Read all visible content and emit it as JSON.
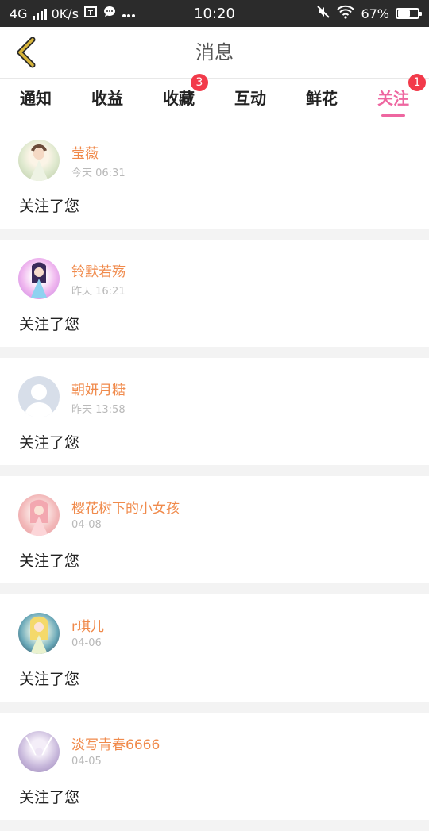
{
  "status_bar": {
    "network": "4G",
    "speed": "0K/s",
    "time": "10:20",
    "battery": "67%",
    "battery_level": 0.67
  },
  "header": {
    "title": "消息"
  },
  "tabs": [
    {
      "label": "通知",
      "badge": ""
    },
    {
      "label": "收益",
      "badge": ""
    },
    {
      "label": "收藏",
      "badge": "3"
    },
    {
      "label": "互动",
      "badge": ""
    },
    {
      "label": "鲜花",
      "badge": ""
    },
    {
      "label": "关注",
      "badge": "1",
      "active": true
    }
  ],
  "colors": {
    "accent": "#ee66a0",
    "name": "#f08a4b",
    "badge": "#f23a4a",
    "back_arrow": "#d8b53a"
  },
  "items": [
    {
      "name": "莹薇",
      "time": "今天 06:31",
      "message": "关注了您"
    },
    {
      "name": "铃默若殇",
      "time": "昨天 16:21",
      "message": "关注了您"
    },
    {
      "name": "朝妍月糖",
      "time": "昨天 13:58",
      "message": "关注了您"
    },
    {
      "name": "樱花树下的小女孩",
      "time": "04-08",
      "message": "关注了您"
    },
    {
      "name": "r琪儿",
      "time": "04-06",
      "message": "关注了您"
    },
    {
      "name": "淡写青春6666",
      "time": "04-05",
      "message": "关注了您"
    }
  ]
}
